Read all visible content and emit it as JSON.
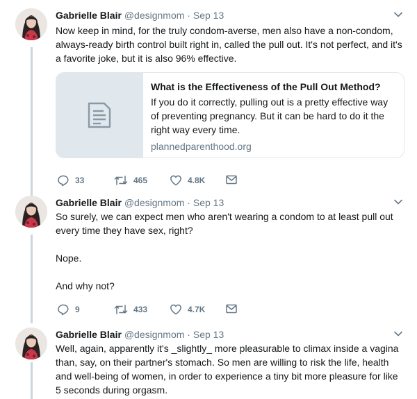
{
  "tweets": [
    {
      "name": "Gabrielle Blair",
      "handle": "@designmom",
      "separator": "·",
      "date": "Sep 13",
      "paragraphs": [
        "Now keep in mind, for the truly condom-averse, men also have a non-condom, always-ready birth control built right in, called the pull out. It's not perfect, and it's a favorite joke, but it is also 96% effective."
      ],
      "card": {
        "title": "What is the Effectiveness of the Pull Out Method?",
        "description": "If you do it correctly, pulling out is a pretty effective way of preventing pregnancy. But it can be hard to do it the right way every time.",
        "domain": "plannedparenthood.org",
        "thumb_icon": "document-icon"
      },
      "replies": "33",
      "retweets": "465",
      "likes": "4.8K"
    },
    {
      "name": "Gabrielle Blair",
      "handle": "@designmom",
      "separator": "·",
      "date": "Sep 13",
      "paragraphs": [
        "So surely, we can expect men who aren't wearing a condom to at least pull out every time they have sex, right?",
        "Nope.",
        "And why not?"
      ],
      "replies": "9",
      "retweets": "433",
      "likes": "4.7K"
    },
    {
      "name": "Gabrielle Blair",
      "handle": "@designmom",
      "separator": "·",
      "date": "Sep 13",
      "paragraphs": [
        "Well, again, apparently it's _slightly_ more pleasurable to climax inside a vagina than, say, on their partner's stomach. So men are willing to risk the life, health and well-being of women, in order to experience a tiny bit more pleasure for like 5 seconds during orgasm."
      ]
    }
  ],
  "icons": {
    "reply": "reply-icon",
    "retweet": "retweet-icon",
    "like": "heart-icon",
    "message": "envelope-icon",
    "caret": "chevron-down-icon"
  },
  "colors": {
    "text": "#14171a",
    "muted": "#657786",
    "thread_line": "#ccd6dd",
    "card_border": "#e1e8ed"
  }
}
